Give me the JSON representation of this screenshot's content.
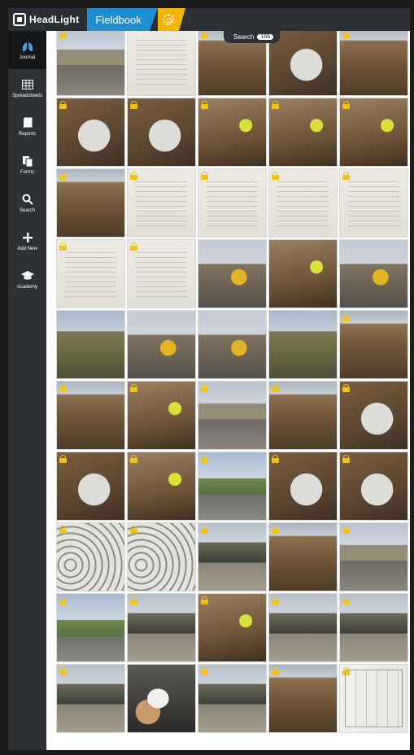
{
  "app": {
    "brand": "HeadLight",
    "section_tab": "Fieldbook",
    "settings_tab_icon": "gear-icon",
    "accent_colors": {
      "brand_blue": "#1f8fd1",
      "settings_yellow": "#f4b400",
      "lock_yellow": "#f3c21a",
      "chrome_dark": "#2d3135"
    }
  },
  "sidebar": {
    "items": [
      {
        "label": "Journal",
        "icon": "lungs-icon",
        "active": true
      },
      {
        "label": "Spreadsheets",
        "icon": "table-icon",
        "active": false
      },
      {
        "label": "Reports",
        "icon": "book-icon",
        "active": false
      },
      {
        "label": "Forms",
        "icon": "documents-icon",
        "active": false
      },
      {
        "label": "Search",
        "icon": "search-icon",
        "active": false
      },
      {
        "label": "Add New",
        "icon": "plus-icon",
        "active": false
      },
      {
        "label": "Academy",
        "icon": "graduation-cap-icon",
        "active": false
      }
    ]
  },
  "search": {
    "label": "Search",
    "count": "166"
  },
  "gallery": {
    "rows": [
      [
        {
          "scene": "road",
          "locked": true
        },
        {
          "scene": "doc",
          "locked": false
        },
        {
          "scene": "trench",
          "locked": true
        },
        {
          "scene": "pipe",
          "locked": true
        },
        {
          "scene": "trench",
          "locked": true
        }
      ],
      [
        {
          "scene": "pipe",
          "locked": true
        },
        {
          "scene": "pipe",
          "locked": true
        },
        {
          "scene": "worker",
          "locked": true
        },
        {
          "scene": "worker",
          "locked": true
        },
        {
          "scene": "worker",
          "locked": true
        }
      ],
      [
        {
          "scene": "trench",
          "locked": true
        },
        {
          "scene": "doc",
          "locked": true
        },
        {
          "scene": "doc",
          "locked": true
        },
        {
          "scene": "doc",
          "locked": true
        },
        {
          "scene": "doc",
          "locked": true
        }
      ],
      [
        {
          "scene": "doc",
          "locked": true
        },
        {
          "scene": "doc",
          "locked": true
        },
        {
          "scene": "machine",
          "locked": false
        },
        {
          "scene": "worker",
          "locked": false
        },
        {
          "scene": "machine",
          "locked": false
        }
      ],
      [
        {
          "scene": "field",
          "locked": false
        },
        {
          "scene": "machine",
          "locked": false
        },
        {
          "scene": "machine",
          "locked": false
        },
        {
          "scene": "field",
          "locked": false
        },
        {
          "scene": "trench",
          "locked": true
        }
      ],
      [
        {
          "scene": "trench",
          "locked": true
        },
        {
          "scene": "worker",
          "locked": true
        },
        {
          "scene": "road",
          "locked": true
        },
        {
          "scene": "trench",
          "locked": true
        },
        {
          "scene": "pipe",
          "locked": true
        }
      ],
      [
        {
          "scene": "pipe",
          "locked": true
        },
        {
          "scene": "worker",
          "locked": true
        },
        {
          "scene": "greenroad",
          "locked": true
        },
        {
          "scene": "pipe",
          "locked": true
        },
        {
          "scene": "pipe",
          "locked": true
        }
      ],
      [
        {
          "scene": "pipes-stack",
          "locked": true
        },
        {
          "scene": "pipes-stack",
          "locked": true
        },
        {
          "scene": "asphalt",
          "locked": true
        },
        {
          "scene": "trench",
          "locked": true
        },
        {
          "scene": "road",
          "locked": true
        }
      ],
      [
        {
          "scene": "greenroad",
          "locked": true
        },
        {
          "scene": "asphalt",
          "locked": true
        },
        {
          "scene": "worker",
          "locked": true
        },
        {
          "scene": "asphalt",
          "locked": true
        },
        {
          "scene": "asphalt",
          "locked": true
        }
      ],
      [
        {
          "scene": "asphalt",
          "locked": true
        },
        {
          "scene": "meter",
          "locked": false
        },
        {
          "scene": "asphalt",
          "locked": true
        },
        {
          "scene": "trench",
          "locked": true
        },
        {
          "scene": "plan",
          "locked": true
        }
      ]
    ]
  }
}
